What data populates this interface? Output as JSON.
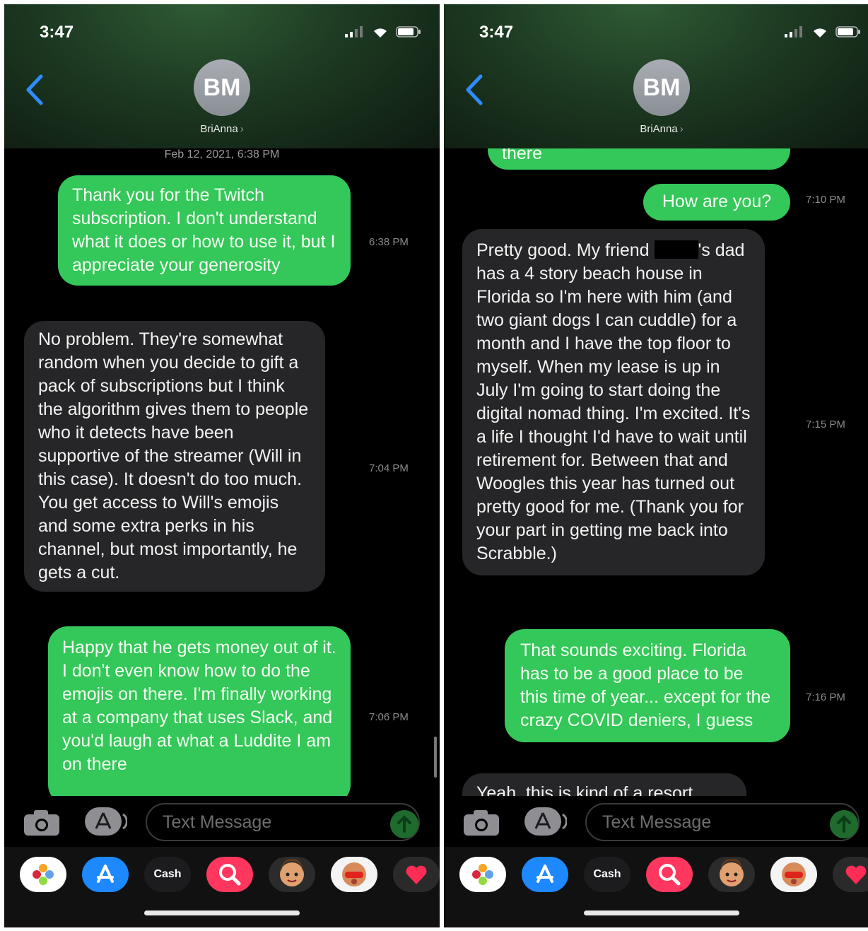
{
  "status_time": "3:47",
  "contact": {
    "initials": "BM",
    "name": "BriAnna"
  },
  "colors": {
    "sent": "#34c759",
    "received": "#262628",
    "background": "#000000"
  },
  "left": {
    "date": "Feb 12, 2021, 6:38 PM",
    "messages": [
      {
        "type": "sent",
        "time": "6:38 PM",
        "text": "Thank you for the Twitch subscription. I don't understand what it does or how to use it, but I appreciate your generosity"
      },
      {
        "type": "received",
        "time": "7:04 PM",
        "text": "No problem. They're somewhat random when you decide to gift a pack of subscriptions but I think the algorithm gives them to people who it detects have been supportive of the streamer (Will in this case).  It doesn't do too much. You get access to Will's emojis and some extra perks in his channel, but most importantly, he gets a cut."
      },
      {
        "type": "sent",
        "time": "7:06 PM",
        "text": "Happy that he gets money out of it. I don't even know how to do the emojis on there. I'm finally working at a company that uses Slack, and you'd laugh at what a Luddite I am on there"
      }
    ]
  },
  "right": {
    "cut_top_text": "there",
    "messages": [
      {
        "type": "sent",
        "time": "7:10 PM",
        "text": "How are you?"
      },
      {
        "type": "received",
        "time": "7:15 PM",
        "text_before": "Pretty good. My friend ",
        "text_after": "'s dad has a 4 story beach house in Florida so I'm here with him (and two giant dogs I can cuddle) for a month and I have the top floor to myself. When my lease is up in July I'm going to start doing the digital nomad thing. I'm excited. It's a life I thought I'd have to wait until retirement for. Between that and Woogles this year has turned out pretty good for me. (Thank you for your part in getting me back into Scrabble.)"
      },
      {
        "type": "sent",
        "time": "7:16 PM",
        "text": "That sounds exciting. Florida has to be a good place to be this time of year... except for the crazy COVID deniers, I guess"
      },
      {
        "type": "received",
        "text": "Yeah, this is kind of a resort"
      }
    ]
  },
  "input": {
    "placeholder": "Text Message"
  },
  "dock_apps": [
    {
      "name": "photos-icon"
    },
    {
      "name": "app-store-icon"
    },
    {
      "name": "apple-cash-icon",
      "label": "Cash"
    },
    {
      "name": "search-images-icon"
    },
    {
      "name": "memoji-icon"
    },
    {
      "name": "animoji-icon"
    },
    {
      "name": "digital-touch-icon"
    }
  ]
}
